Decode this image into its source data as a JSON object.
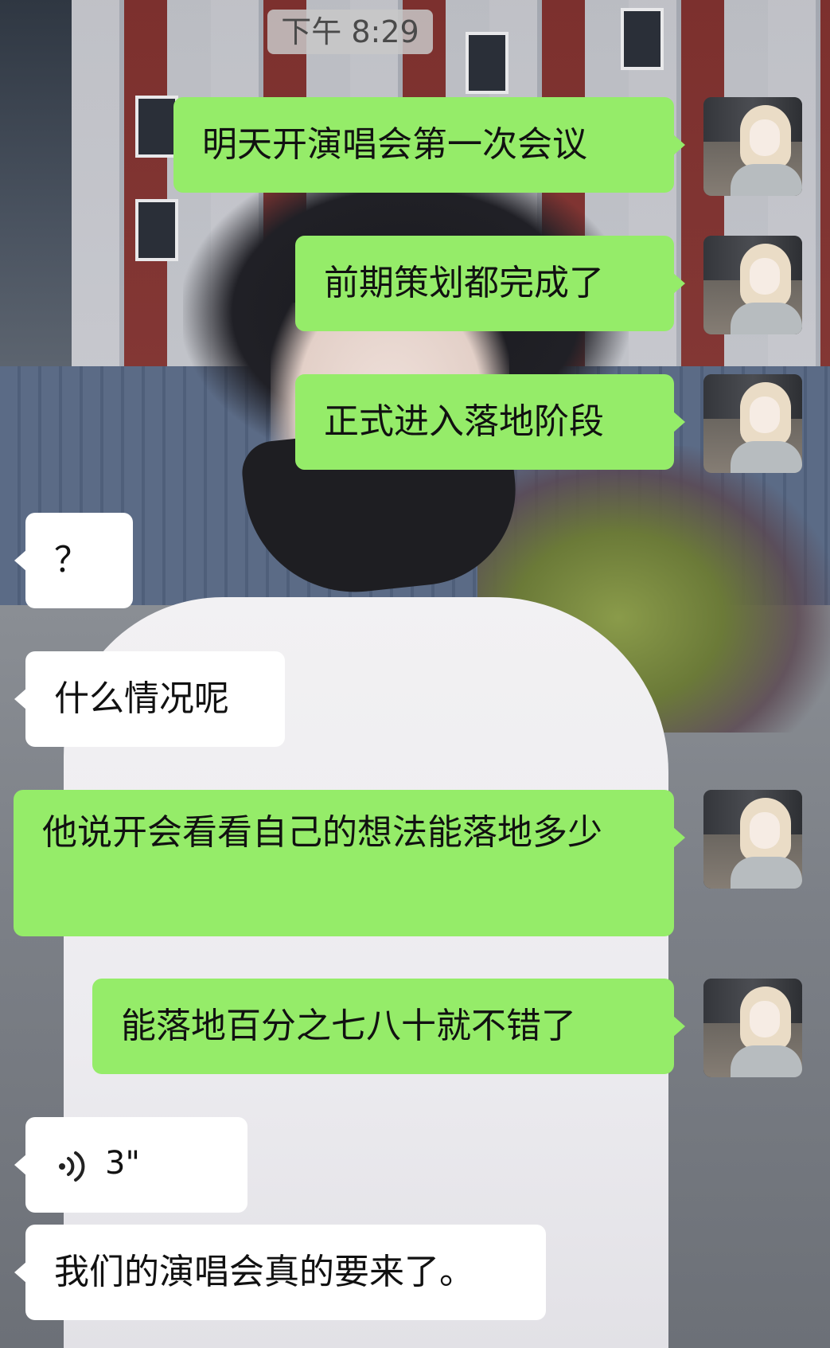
{
  "timestamp": "下午 8:29",
  "messages": [
    {
      "side": "sent",
      "text": "明天开演唱会第一次会议"
    },
    {
      "side": "sent",
      "text": "前期策划都完成了"
    },
    {
      "side": "sent",
      "text": "正式进入落地阶段"
    },
    {
      "side": "received",
      "text": "？"
    },
    {
      "side": "received",
      "text": "什么情况呢"
    },
    {
      "side": "sent",
      "text": "他说开会看看自己的想法能落地多少"
    },
    {
      "side": "sent",
      "text": "能落地百分之七八十就不错了"
    },
    {
      "side": "received",
      "type": "voice",
      "duration": "3\"",
      "icon": "voice-wave-icon"
    },
    {
      "side": "received",
      "text": "我们的演唱会真的要来了。"
    }
  ],
  "colors": {
    "sent_bubble": "#95ec69",
    "received_bubble": "#ffffff",
    "timestamp_bg": "#c8c8c8"
  }
}
